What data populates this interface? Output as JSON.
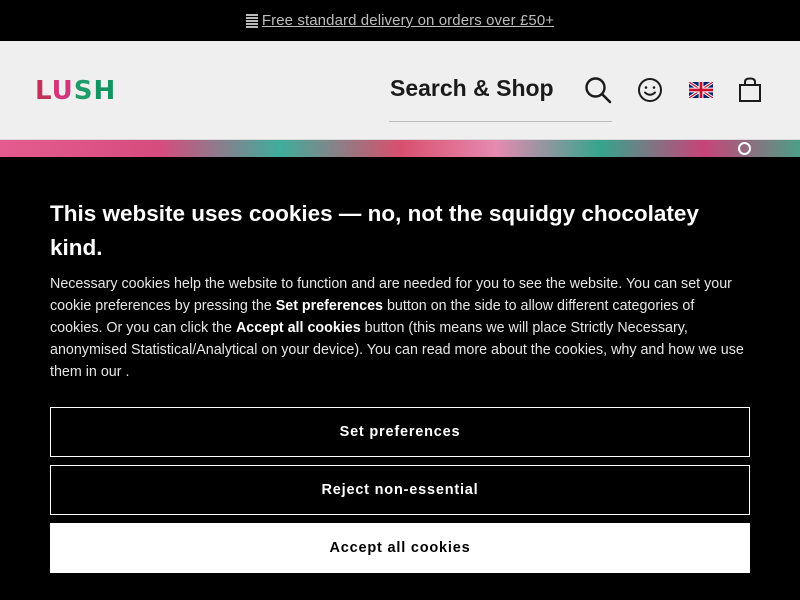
{
  "promo": {
    "icon": "delivery-box-icon",
    "text": "Free standard delivery on orders over £50+"
  },
  "header": {
    "logo_letters": [
      "L",
      "U",
      "S",
      "H"
    ],
    "search_label": "Search & Shop",
    "icons": [
      "search-icon",
      "account-smiley-icon",
      "uk-flag-icon",
      "shopping-bag-icon"
    ]
  },
  "cookie": {
    "title": "This website uses cookies — no, not the squidgy chocolatey kind.",
    "body": {
      "part1": "Necessary cookies help the website to function and are needed for you to see the website. You can set your cookie preferences by pressing the ",
      "bold1": "Set preferences",
      "part2": " button on the side to allow different categories of cookies. Or you can click the ",
      "bold2": "Accept all cookies",
      "part3": " button (this means we will place Strictly Necessary, anonymised Statistical/Analytical on your device). You can read more about the cookies, why and how we use them in our ."
    },
    "buttons": {
      "set_preferences": "Set preferences",
      "reject": "Reject non-essential",
      "accept": "Accept all cookies"
    }
  },
  "colors": {
    "logo_pink": "#c0325a",
    "logo_green": "#1d9d6b",
    "background": "#000000",
    "header_bg": "#efefef"
  }
}
